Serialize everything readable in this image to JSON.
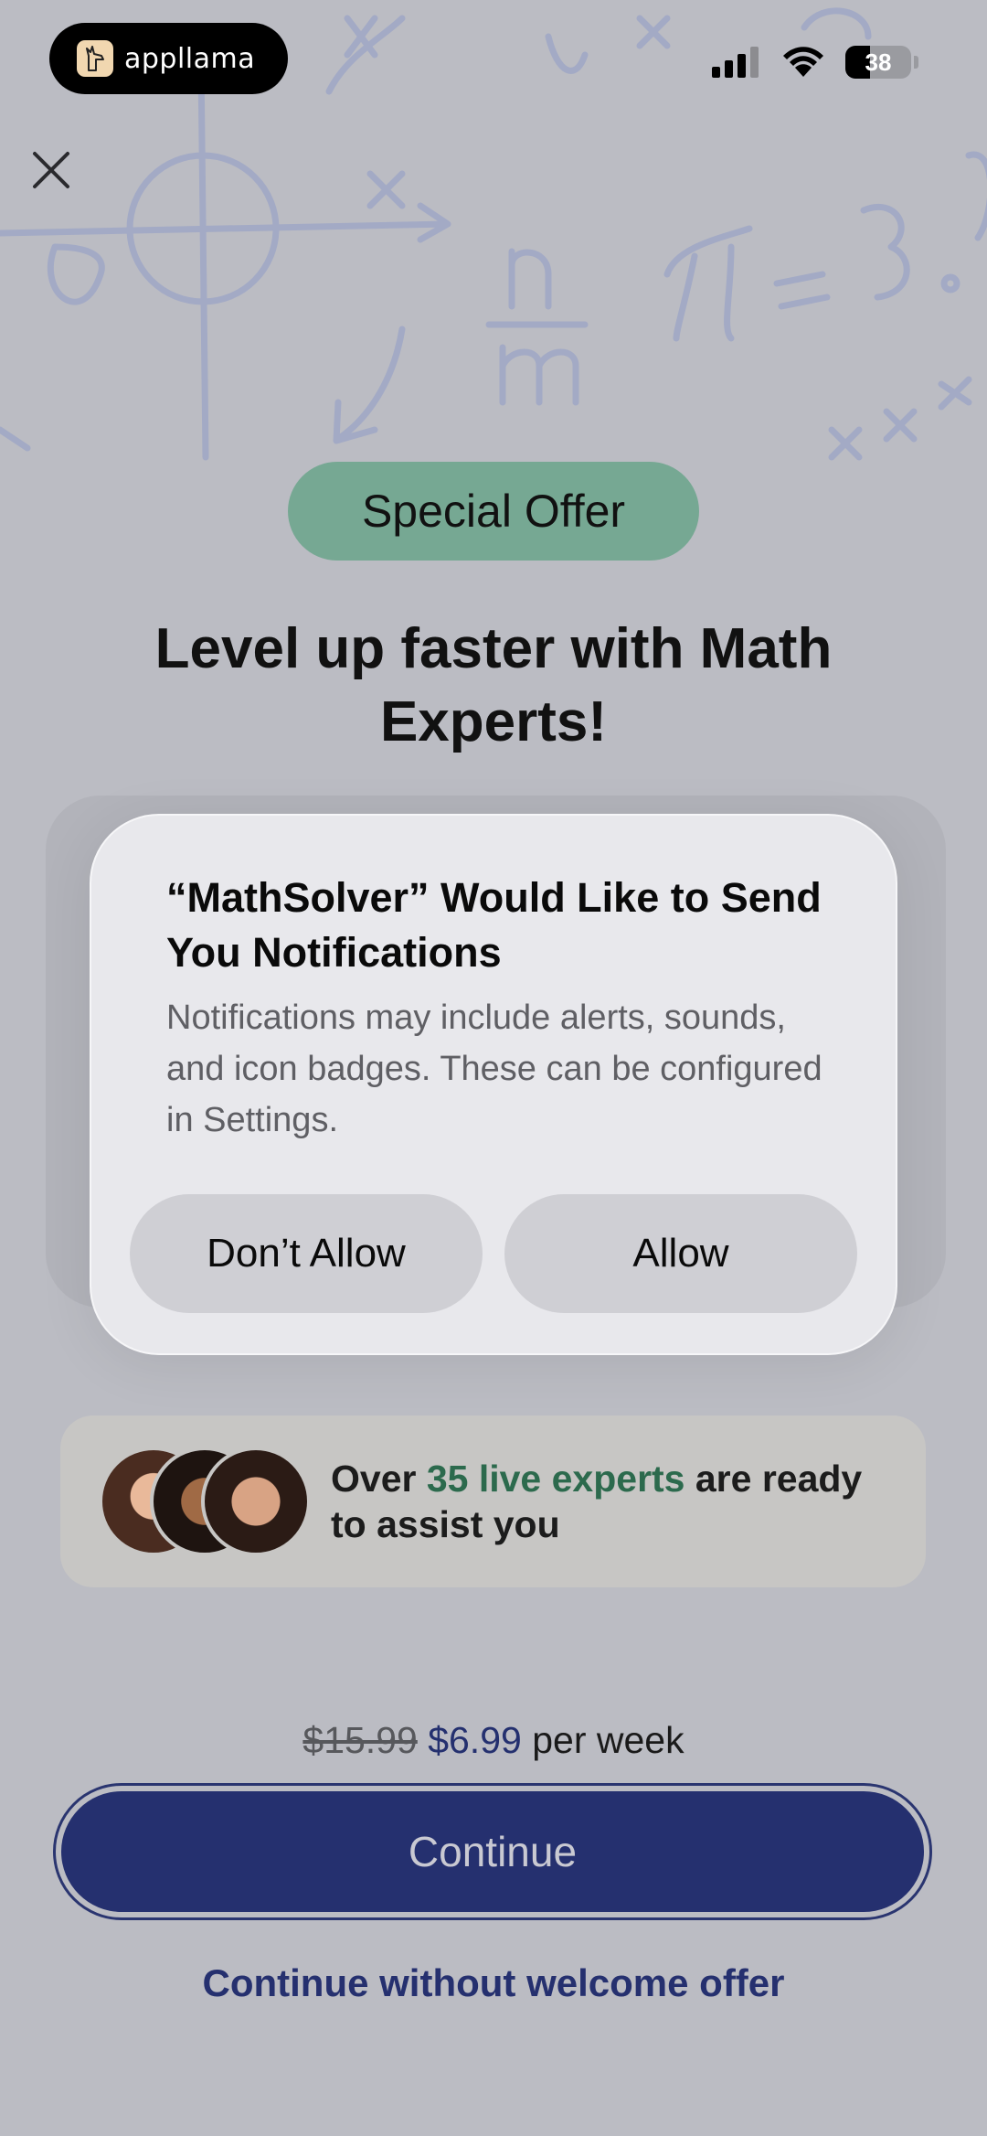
{
  "status_bar": {
    "brand_name": "appllama",
    "battery_level": "38",
    "battery_fraction": 0.38
  },
  "icons": {
    "close": "close-icon",
    "signal": "cellular-signal-icon",
    "wifi": "wifi-icon",
    "battery": "battery-icon",
    "brand": "llama-logo-icon"
  },
  "offer": {
    "badge": "Special Offer",
    "headline": "Level up faster with Math Experts!"
  },
  "dialog": {
    "title": "“MathSolver” Would Like to Send You Notifications",
    "body": "Notifications may include alerts, sounds, and icon badges. These can be configured in Settings.",
    "deny_label": "Don’t Allow",
    "allow_label": "Allow"
  },
  "experts": {
    "prefix": "Over ",
    "highlight": "35 live experts",
    "suffix": " are ready to assist you"
  },
  "pricing": {
    "old_price": "$15.99",
    "new_price": "$6.99",
    "period": "per week"
  },
  "actions": {
    "continue_label": "Continue",
    "skip_label": "Continue without welcome offer"
  },
  "colors": {
    "accent": "#25306f",
    "badge": "#76a893",
    "highlight": "#2c6a4d"
  }
}
